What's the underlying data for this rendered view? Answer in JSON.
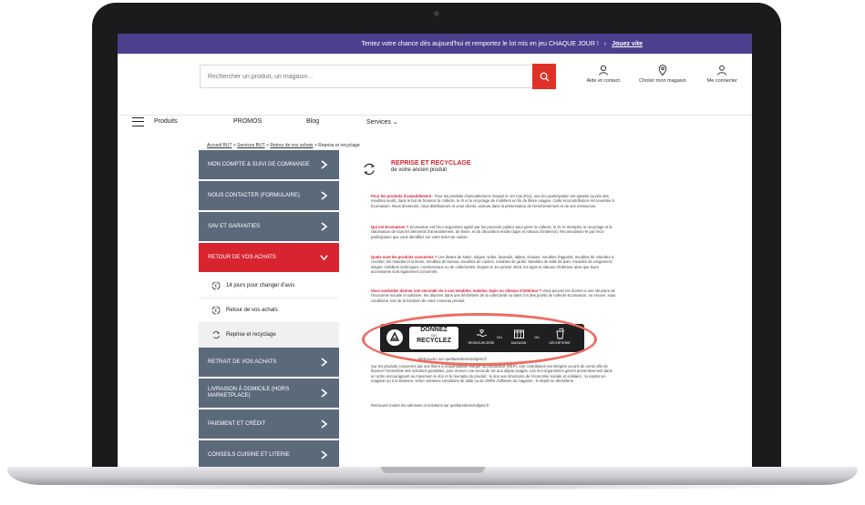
{
  "promo": {
    "text": "Tentez votre chance dès aujourd'hui et remportez le lot mis en jeu CHAQUE JOUR !",
    "link": "Jouez vite"
  },
  "search": {
    "placeholder": "Rechercher un produit, un magasin..."
  },
  "header_tools": [
    {
      "label": "Aide et contact",
      "icon": "help-person-icon"
    },
    {
      "label": "Choisir mon magasin",
      "icon": "location-pin-icon"
    },
    {
      "label": "Me connecter",
      "icon": "user-icon"
    }
  ],
  "nav": {
    "menu": "Produits",
    "promos": "PROMOS",
    "blog": "Blog",
    "services": "Services"
  },
  "breadcrumb": {
    "home": "Accueil BUT",
    "services": "Services BUT",
    "retour": "Retour de vos achats",
    "current": "Reprise et recyclage"
  },
  "sidebar": {
    "items": [
      "MON COMPTE & SUIVI DE COMMANDE",
      "NOUS CONTACTER (FORMULAIRE)",
      "SAV ET GARANTIES",
      "RETOUR DE VOS ACHATS"
    ],
    "subitems": [
      "14 jours pour changer d'avis",
      "Retour de vos achats",
      "Reprise et recyclage"
    ],
    "items_after": [
      "RETRAIT DE VOS ACHATS",
      "LIVRAISON À DOMICILE (HORS MARKETPLACE)",
      "PAIEMENT ET CRÉDIT",
      "CONSEILS CUISINE ET LITERIE"
    ]
  },
  "content": {
    "title": "REPRISE ET RECYCLAGE",
    "subtitle": "de votre ancien produit",
    "p1_lead": "Pour les produits d'ameublement :",
    "p1": "Pour les produits d'ameublement. Depuis le 1er mai 2013, une éco-participation est ajoutée au prix des meubles neufs, dans le but de financer la collecte, le tri et le recyclage de mobiliers en fin de filière usagée. Cette écocontribution est reversée à Ecomaison. Nous devenons, nous distributeurs et vous clients, acteurs dans la préservation de l'environnement et de ses ressources.",
    "p2_lead": "Qui est Ecomaison ?",
    "p2": "Ecomaison est l'éco-organisme agréé par les pouvoirs publics pour gérer la collecte, le tri, le réemploi, le recyclage et la valorisation de tous les éléments d'ameublement, de literie, et de décoration textile (tapis et rideaux d'intérieur). Reconnaissez-le par l'éco-participation que vous identifiez sur votre ticket de caisse.",
    "p3_lead": "Quels sont les produits concernés ?",
    "p3": "Les divans de salon, sièges, sofas, fauteuils, tables, chaises, meubles d'appoint, meubles de chambre à coucher, les matelas et la literie, meubles de bureau, meubles de cuisine, meubles de jardin. Meubles de salle de bain, meubles de rangement, sièges, mobiliers techniques, commerciaux ou de collectivités. Depuis le 1er janvier 2023, les tapis et rideaux d'intérieur ainsi que leurs accessoires sont également concernés.",
    "p4_lead": "Vous souhaitez donner une seconde vie à vos meubles, matelas, tapis ou rideaux d'intérieur ?",
    "p4": "Vous pouvez les donner à une structure de l'économie sociale et solidaire, les déposer dans une déchèterie de la collectivité ou dans l'un des points de collecte Ecomaison, ou encore, sous conditions, lors de la livraison de votre nouveau produit.",
    "banner": {
      "l1": "DONNEZ",
      "l2": "OU",
      "l3": "RECYCLEZ",
      "opt1": "RESSOURCERIE",
      "opt2": "MAGASIN",
      "opt3": "DÉCHÈTERIE",
      "ou": "OU"
    },
    "caption": "Retrouvez sur quefairedemesobjets.fr",
    "p5": "Sur les produits concernés par une filière à responsabilité élargie du producteur (REP), une contribution est intégrée au prix de vente afin de financer l'ensemble des solutions possibles, pour donner une seconde vie aux objets usagés. Les éco-organismes gèrent préventivement dans un ordre encourageant au maximum le don et le réemploi du produit : le don aux structures de l'économie sociale et solidaire ; la reprise en magasin ou à la livraison, selon certaines conditions de taille ou de chiffre d'affaires du magasin ; le dépôt en déchèterie.",
    "p6": "Retrouvez toutes les adresses et solutions sur quefairedemesobjets.fr"
  }
}
